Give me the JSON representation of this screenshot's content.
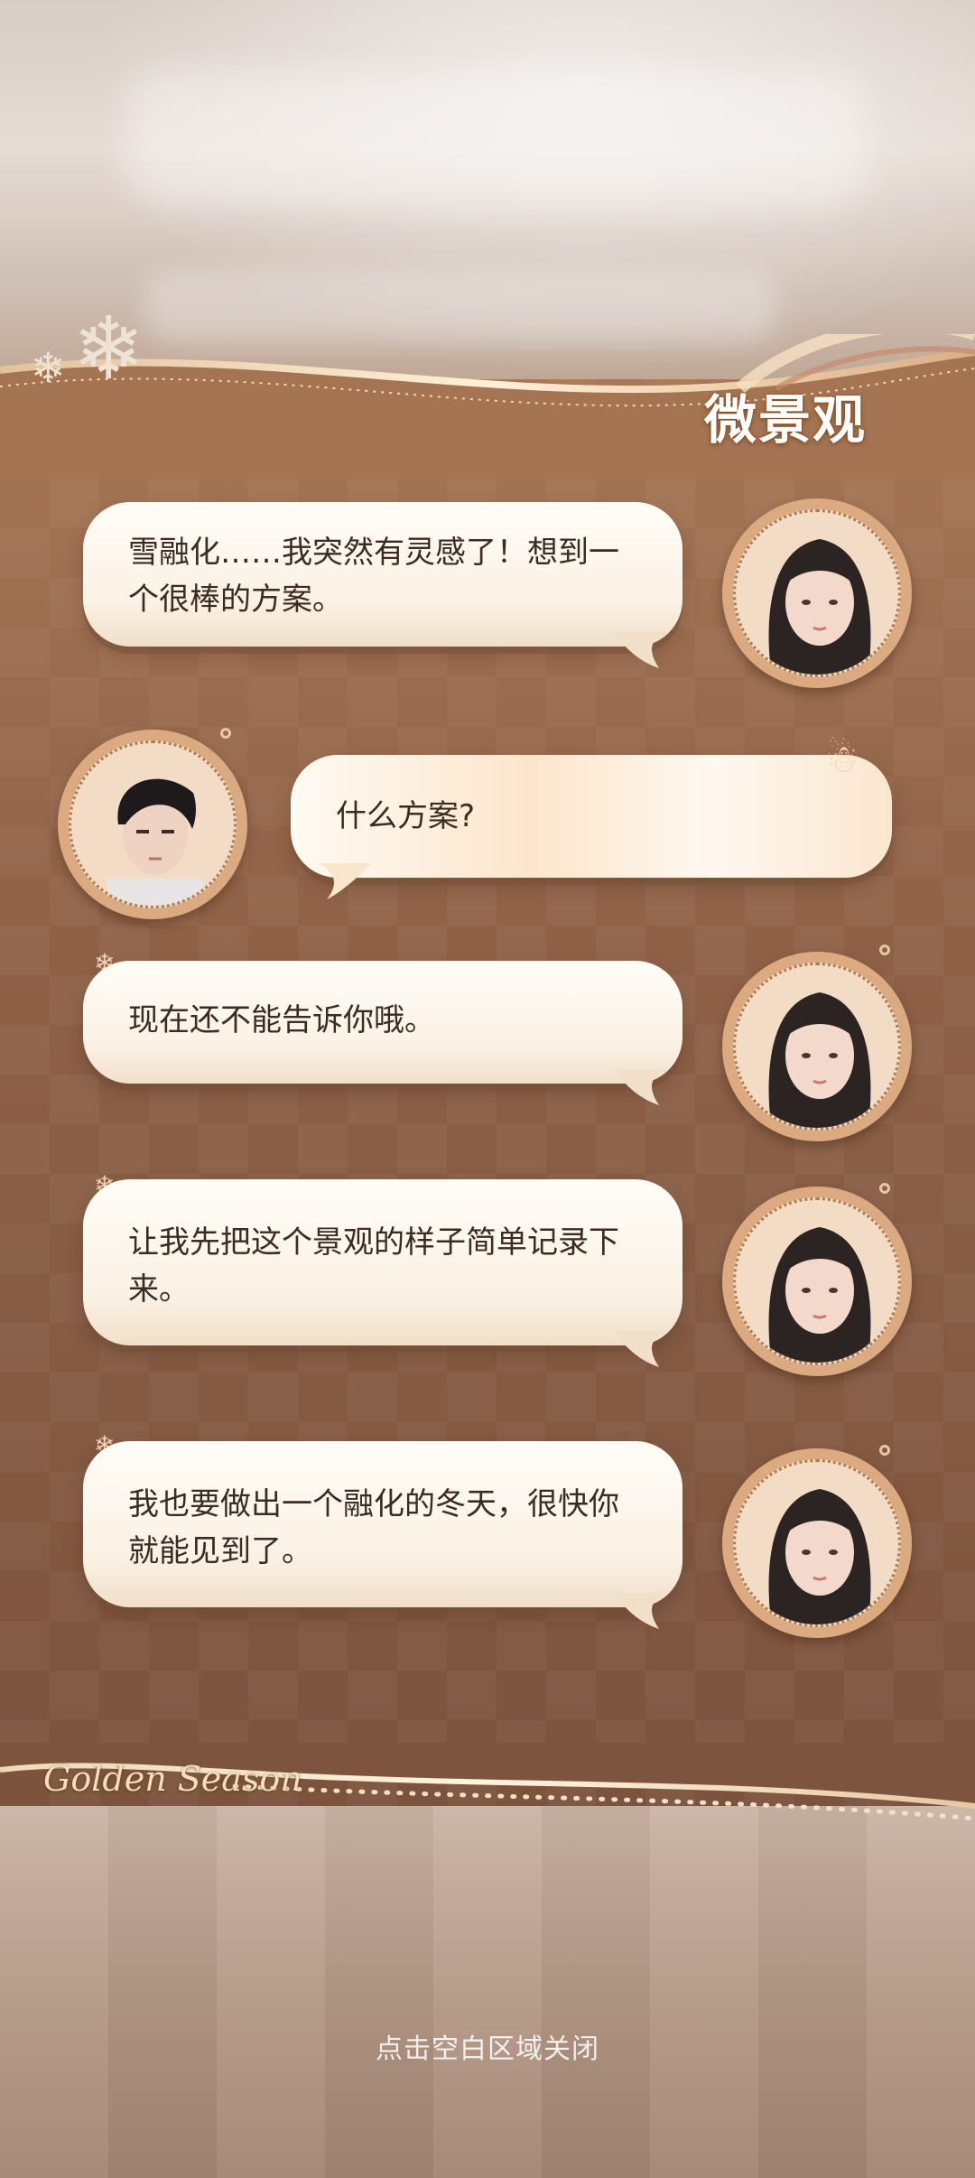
{
  "title": "微景观",
  "season_script": "Golden Season",
  "close_hint": "点击空白区域关闭",
  "messages": [
    {
      "speaker": "heroine",
      "text": "雪融化……我突然有灵感了！想到一个很棒的方案。"
    },
    {
      "speaker": "male",
      "text": "什么方案?"
    },
    {
      "speaker": "heroine",
      "text": "现在还不能告诉你哦。"
    },
    {
      "speaker": "heroine",
      "text": "让我先把这个景观的样子简单记录下来。"
    },
    {
      "speaker": "heroine",
      "text": "我也要做出一个融化的冬天，很快你就能见到了。"
    }
  ],
  "colors": {
    "panel": "#8f6348",
    "bubble": "#fffdf8",
    "text": "#3d2b21",
    "accent": "#e8c496"
  },
  "icons": [
    "snowflake-icon",
    "snowman-icon"
  ]
}
